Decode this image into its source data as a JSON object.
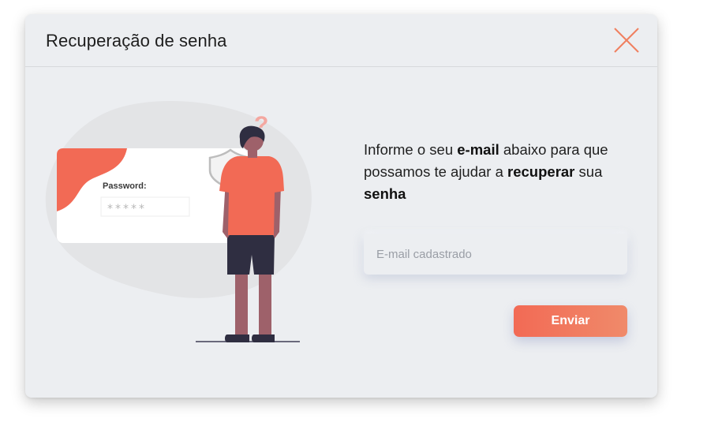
{
  "modal": {
    "title": "Recuperação de senha",
    "close_icon": "close-x-icon",
    "accent_color": "#f26a55"
  },
  "illustration": {
    "password_label": "Password:",
    "password_mask": "*****",
    "question_mark": "?",
    "icons": [
      "padlock-shield-icon",
      "question-mark-icon"
    ]
  },
  "instructions": {
    "segments": [
      {
        "text": "Informe o seu ",
        "bold": false
      },
      {
        "text": "e-mail",
        "bold": true
      },
      {
        "text": " abaixo para que possamos te ajudar a ",
        "bold": false
      },
      {
        "text": "recuperar",
        "bold": true
      },
      {
        "text": " sua ",
        "bold": false
      },
      {
        "text": "senha",
        "bold": true
      }
    ]
  },
  "form": {
    "email_value": "",
    "email_placeholder": "E-mail cadastrado",
    "submit_label": "Enviar"
  }
}
